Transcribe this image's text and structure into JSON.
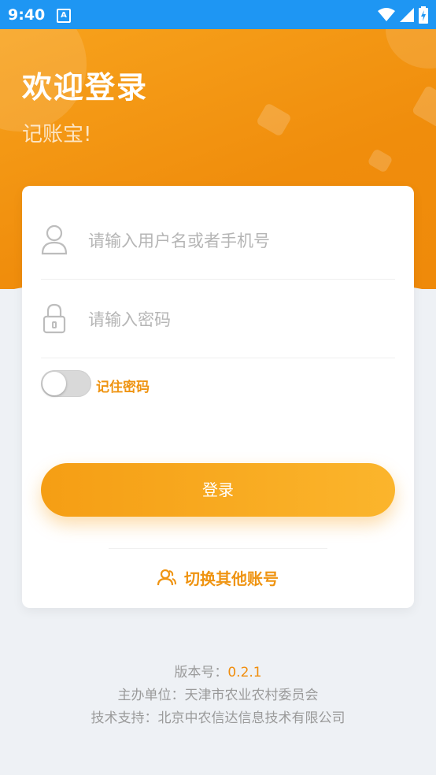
{
  "status_bar": {
    "time": "9:40",
    "a_icon_glyph": "A"
  },
  "header": {
    "title": "欢迎登录",
    "subtitle": "记账宝!"
  },
  "form": {
    "username": {
      "placeholder": "请输入用户名或者手机号",
      "value": ""
    },
    "password": {
      "placeholder": "请输入密码",
      "value": ""
    },
    "remember": {
      "label": "记住密码",
      "checked": false
    },
    "login_label": "登录",
    "switch_account_label": "切换其他账号"
  },
  "footer": {
    "version_label": "版本号：",
    "version_value": "0.2.1",
    "sponsor": "主办单位：天津市农业农村委员会",
    "support": "技术支持：北京中农信达信息技术有限公司"
  },
  "colors": {
    "accent": "#ef9412",
    "status_bar": "#1e96f3",
    "hero": "#f08d0c"
  }
}
